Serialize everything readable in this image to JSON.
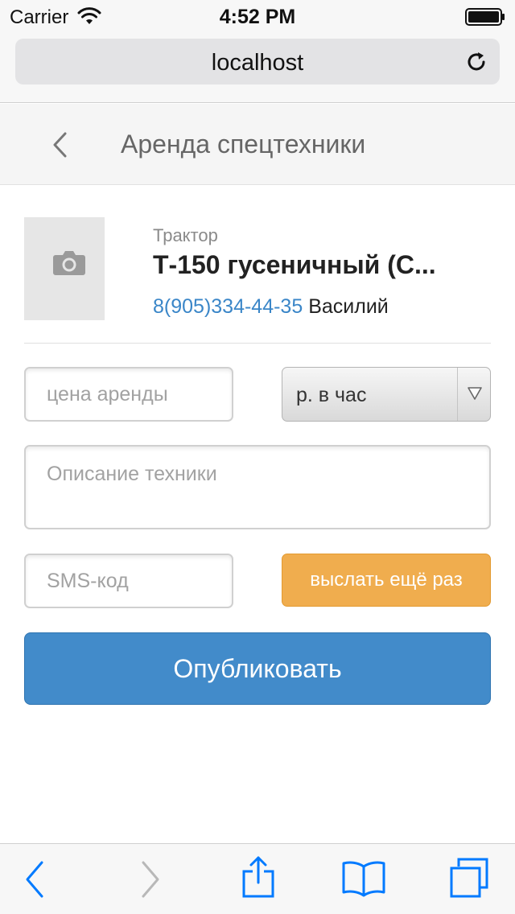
{
  "status_bar": {
    "carrier": "Carrier",
    "time": "4:52 PM",
    "icons": [
      "wifi-icon",
      "battery-icon"
    ]
  },
  "browser": {
    "address": "localhost",
    "icons": [
      "reload-icon"
    ],
    "toolbar_icons": [
      "back-icon",
      "forward-icon",
      "share-icon",
      "bookmarks-icon",
      "tabs-icon"
    ],
    "accent_color": "#007aff"
  },
  "header": {
    "title": "Аренда спецтехники",
    "icons": [
      "back-arrow-icon"
    ]
  },
  "item": {
    "category": "Трактор",
    "title": "Т-150 гусеничный (С...",
    "phone": "8(905)334-44-35",
    "owner": "Василий",
    "photo_icon": "camera-icon"
  },
  "form": {
    "price_placeholder": "цена аренды",
    "unit_selected": "р. в час",
    "description_placeholder": "Описание техники",
    "sms_placeholder": "SMS-код",
    "resend_label": "выслать ещё раз",
    "publish_label": "Опубликовать"
  },
  "colors": {
    "publish": "#428bca",
    "resend": "#f0ad4e",
    "link": "#3a86c8"
  }
}
